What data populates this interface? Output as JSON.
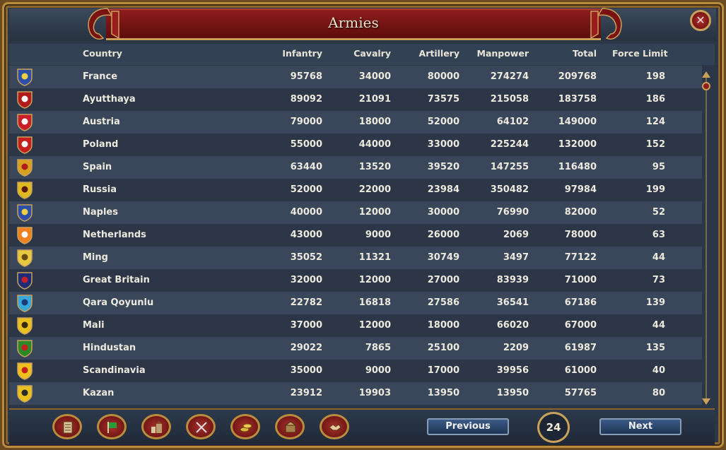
{
  "window": {
    "title": "Armies",
    "close_icon": "close-icon"
  },
  "columns": {
    "country": "Country",
    "infantry": "Infantry",
    "cavalry": "Cavalry",
    "artillery": "Artillery",
    "manpower": "Manpower",
    "total": "Total",
    "force_limit": "Force Limit"
  },
  "rows": [
    {
      "country": "France",
      "infantry": "95768",
      "cavalry": "34000",
      "artillery": "80000",
      "manpower": "274274",
      "total": "209768",
      "force_limit": "198",
      "flag": [
        "#2c4fa8",
        "#f0d040"
      ]
    },
    {
      "country": "Ayutthaya",
      "infantry": "89092",
      "cavalry": "21091",
      "artillery": "73575",
      "manpower": "215058",
      "total": "183758",
      "force_limit": "186",
      "flag": [
        "#b01c1c",
        "#ffffff"
      ]
    },
    {
      "country": "Austria",
      "infantry": "79000",
      "cavalry": "18000",
      "artillery": "52000",
      "manpower": "64102",
      "total": "149000",
      "force_limit": "124",
      "flag": [
        "#c8202a",
        "#ffffff"
      ]
    },
    {
      "country": "Poland",
      "infantry": "55000",
      "cavalry": "44000",
      "artillery": "33000",
      "manpower": "225244",
      "total": "132000",
      "force_limit": "152",
      "flag": [
        "#c41e1e",
        "#f4f4f4"
      ]
    },
    {
      "country": "Spain",
      "infantry": "63440",
      "cavalry": "13520",
      "artillery": "39520",
      "manpower": "147255",
      "total": "116480",
      "force_limit": "95",
      "flag": [
        "#d8a020",
        "#b01c1c"
      ]
    },
    {
      "country": "Russia",
      "infantry": "52000",
      "cavalry": "22000",
      "artillery": "23984",
      "manpower": "350482",
      "total": "97984",
      "force_limit": "199",
      "flag": [
        "#e0b820",
        "#5a1a10"
      ]
    },
    {
      "country": "Naples",
      "infantry": "40000",
      "cavalry": "12000",
      "artillery": "30000",
      "manpower": "76990",
      "total": "82000",
      "force_limit": "52",
      "flag": [
        "#2c4fa8",
        "#f0d040"
      ]
    },
    {
      "country": "Netherlands",
      "infantry": "43000",
      "cavalry": "9000",
      "artillery": "26000",
      "manpower": "2069",
      "total": "78000",
      "force_limit": "63",
      "flag": [
        "#f08020",
        "#ffffff"
      ]
    },
    {
      "country": "Ming",
      "infantry": "35052",
      "cavalry": "11321",
      "artillery": "30749",
      "manpower": "3497",
      "total": "77122",
      "force_limit": "44",
      "flag": [
        "#e8c840",
        "#6a4a10"
      ]
    },
    {
      "country": "Great Britain",
      "infantry": "32000",
      "cavalry": "12000",
      "artillery": "27000",
      "manpower": "83939",
      "total": "71000",
      "force_limit": "73",
      "flag": [
        "#1c2c78",
        "#c81e2a"
      ]
    },
    {
      "country": "Qara Qoyunlu",
      "infantry": "22782",
      "cavalry": "16818",
      "artillery": "27586",
      "manpower": "36541",
      "total": "67186",
      "force_limit": "139",
      "flag": [
        "#38a8d8",
        "#1c3c78"
      ]
    },
    {
      "country": "Mali",
      "infantry": "37000",
      "cavalry": "12000",
      "artillery": "18000",
      "manpower": "66020",
      "total": "67000",
      "force_limit": "44",
      "flag": [
        "#e8c020",
        "#3a2a10"
      ]
    },
    {
      "country": "Hindustan",
      "infantry": "29022",
      "cavalry": "7865",
      "artillery": "25100",
      "manpower": "2209",
      "total": "61987",
      "force_limit": "135",
      "flag": [
        "#2a8a2a",
        "#c81e1e"
      ]
    },
    {
      "country": "Scandinavia",
      "infantry": "35000",
      "cavalry": "9000",
      "artillery": "17000",
      "manpower": "39956",
      "total": "61000",
      "force_limit": "40",
      "flag": [
        "#f0c020",
        "#c81e1e"
      ]
    },
    {
      "country": "Kazan",
      "infantry": "23912",
      "cavalry": "19903",
      "artillery": "13950",
      "manpower": "13950",
      "total": "57765",
      "force_limit": "80",
      "flag": [
        "#e8c020",
        "#2a2a2a"
      ]
    }
  ],
  "footer": {
    "previous_label": "Previous",
    "next_label": "Next",
    "page_number": "24",
    "tool_icons": [
      "ledger-icon",
      "flag-icon",
      "buildings-icon",
      "crossed-swords-icon",
      "coins-icon",
      "trade-goods-icon",
      "handshake-icon"
    ]
  },
  "colors": {
    "accent_red": "#8e1c1c",
    "gold_trim": "#b98c3e",
    "row_text": "#ece9de"
  }
}
